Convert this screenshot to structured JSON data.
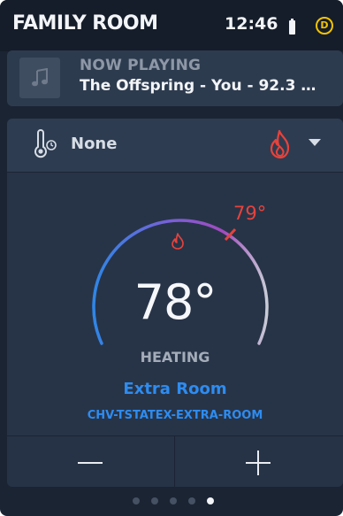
{
  "header": {
    "room_title": "FAMILY ROOM",
    "time": "12:46",
    "battery_icon": "battery-icon",
    "user_badge": "D",
    "badge_color": "#f3c400"
  },
  "now_playing": {
    "label": "NOW PLAYING",
    "track": "The Offspring - You - 92.3 …",
    "art_icon": "music-note-icon"
  },
  "thermostat": {
    "mode_icon": "thermometer-icon",
    "mode_label": "None",
    "system_icon": "flame-icon",
    "current_temp": "78°",
    "setpoint": "79°",
    "status": "HEATING",
    "zone_name": "Extra Room",
    "zone_id": "CHV-TSTATEX-EXTRA-ROOM",
    "decrease_icon": "minus-icon",
    "increase_icon": "plus-icon",
    "colors": {
      "heat_accent": "#e8423b",
      "zone_text": "#2e8cf0",
      "arc_start": "#2f86e6",
      "arc_mid": "#9b4fc3",
      "arc_end": "#c8ccd6"
    }
  },
  "pagination": {
    "total": 5,
    "active_index": 4
  }
}
